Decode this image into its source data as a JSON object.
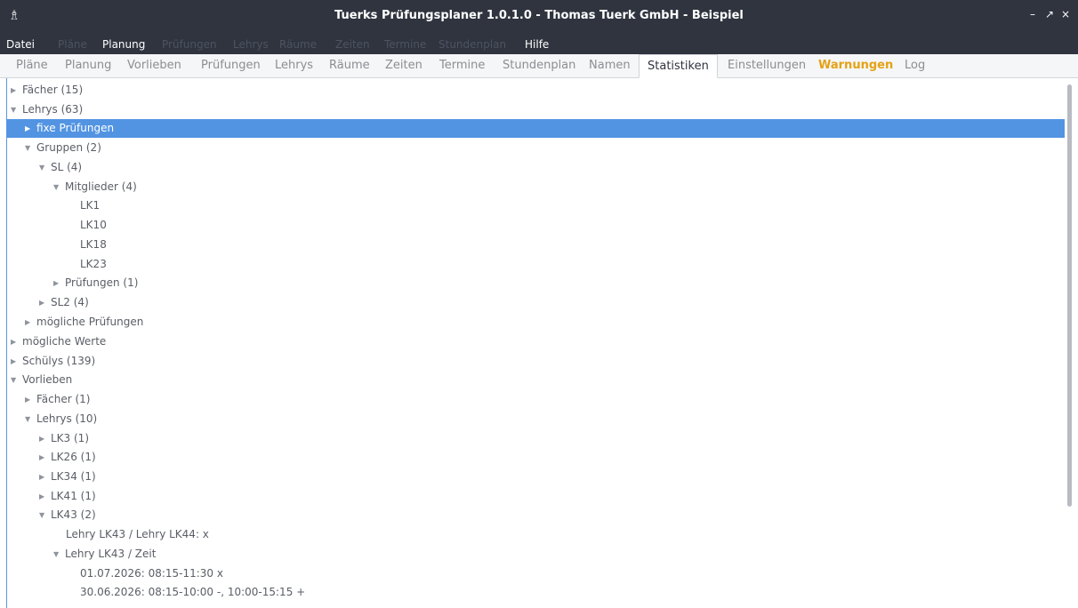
{
  "window": {
    "title": "Tuerks Prüfungsplaner 1.0.1.0 - Thomas Tuerk GmbH - Beispiel",
    "app_icon": "♗",
    "minimize": "–",
    "restore": "↗",
    "close": "×"
  },
  "menubar": {
    "items": [
      {
        "label": "Datei",
        "enabled": true
      },
      {
        "label": "Pläne",
        "enabled": false
      },
      {
        "label": "Planung",
        "enabled": true
      },
      {
        "label": "Prüfungen",
        "enabled": false
      },
      {
        "label": "Lehrys",
        "enabled": false
      },
      {
        "label": "Räume",
        "enabled": false
      },
      {
        "label": "Zeiten",
        "enabled": false
      },
      {
        "label": "Termine",
        "enabled": false
      },
      {
        "label": "Stundenplan",
        "enabled": false
      },
      {
        "label": "Hilfe",
        "enabled": true
      }
    ]
  },
  "tabs": {
    "items": [
      {
        "label": "Pläne"
      },
      {
        "label": "Planung"
      },
      {
        "label": "Vorlieben"
      },
      {
        "label": "Prüfungen"
      },
      {
        "label": "Lehrys"
      },
      {
        "label": "Räume"
      },
      {
        "label": "Zeiten"
      },
      {
        "label": "Termine"
      },
      {
        "label": "Stundenplan"
      },
      {
        "label": "Namen"
      },
      {
        "label": "Statistiken"
      },
      {
        "label": "Einstellungen"
      },
      {
        "label": "Warnungen"
      },
      {
        "label": "Log"
      }
    ],
    "selected": "Statistiken",
    "warning_tab": "Warnungen"
  },
  "tree": {
    "rows": [
      {
        "label": "Fächer (15)",
        "expanded": false
      },
      {
        "label": "Lehrys (63)",
        "expanded": true
      },
      {
        "label": "fixe Prüfungen",
        "expanded": false,
        "selected": true
      },
      {
        "label": "Gruppen (2)",
        "expanded": true
      },
      {
        "label": "SL (4)",
        "expanded": true
      },
      {
        "label": "Mitglieder (4)",
        "expanded": true
      },
      {
        "label": "LK1"
      },
      {
        "label": "LK10"
      },
      {
        "label": "LK18"
      },
      {
        "label": "LK23"
      },
      {
        "label": "Prüfungen (1)",
        "expanded": false
      },
      {
        "label": "SL2 (4)",
        "expanded": false
      },
      {
        "label": "mögliche Prüfungen",
        "expanded": false
      },
      {
        "label": "mögliche Werte",
        "expanded": false
      },
      {
        "label": "Schülys (139)",
        "expanded": false
      },
      {
        "label": "Vorlieben",
        "expanded": true
      },
      {
        "label": "Fächer (1)",
        "expanded": false
      },
      {
        "label": "Lehrys (10)",
        "expanded": true
      },
      {
        "label": "LK3 (1)",
        "expanded": false
      },
      {
        "label": "LK26 (1)",
        "expanded": false
      },
      {
        "label": "LK34 (1)",
        "expanded": false
      },
      {
        "label": "LK41 (1)",
        "expanded": false
      },
      {
        "label": "LK43 (2)",
        "expanded": true
      },
      {
        "label": "Lehry LK43 / Lehry LK44: x"
      },
      {
        "label": "Lehry LK43 / Zeit",
        "expanded": true
      },
      {
        "label": "01.07.2026: 08:15-11:30 x"
      },
      {
        "label": "30.06.2026: 08:15-10:00 -, 10:00-15:15 +"
      }
    ]
  },
  "colors": {
    "titlebar_bg": "#2f343f",
    "selection": "#5294e2",
    "warning": "#e4a215",
    "text": "#5a5e66"
  }
}
